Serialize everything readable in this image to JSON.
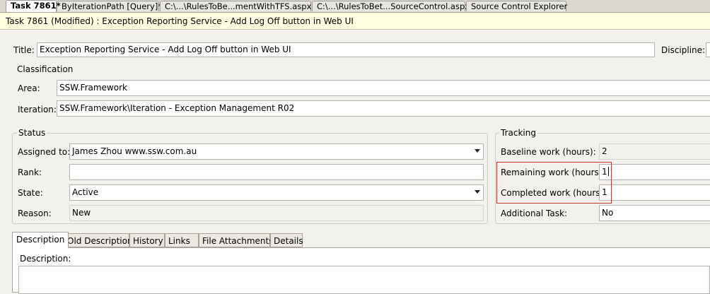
{
  "doc_tabs": [
    {
      "label": "Task 7861*",
      "active": true
    },
    {
      "label": "ByIterationPath [Query]*",
      "active": false
    },
    {
      "label": "C:\\...\\RulesToBe...mentWithTFS.aspx*",
      "active": false
    },
    {
      "label": "C:\\...\\RulesToBet...SourceControl.aspx",
      "active": false
    },
    {
      "label": "Source Control Explorer",
      "active": false
    }
  ],
  "header": {
    "title": "Task 7861 (Modified) : Exception Reporting Service -  Add Log Off button in Web UI"
  },
  "form": {
    "title_label": "Title:",
    "title_value": "Exception Reporting Service -  Add Log Off button in Web UI",
    "discipline_label": "Discipline:",
    "discipline_value": ""
  },
  "classification": {
    "heading": "Classification",
    "area_label": "Area:",
    "area_value": "SSW.Framework",
    "iteration_label": "Iteration:",
    "iteration_value": "SSW.Framework\\Iteration - Exception Management R02"
  },
  "status": {
    "heading": "Status",
    "assigned_label": "Assigned to:",
    "assigned_value": "James Zhou www.ssw.com.au",
    "rank_label": "Rank:",
    "rank_value": "",
    "state_label": "State:",
    "state_value": "Active",
    "reason_label": "Reason:",
    "reason_value": "New"
  },
  "tracking": {
    "heading": "Tracking",
    "baseline_label": "Baseline work (hours):",
    "baseline_value": "2",
    "remaining_label": "Remaining work (hours):",
    "remaining_value": "1",
    "completed_label": "Completed work (hours):",
    "completed_value": "1",
    "additional_label": "Additional Task:",
    "additional_value": "No"
  },
  "bottom_tabs": [
    "Description",
    "Old Description",
    "History",
    "Links",
    "File Attachments",
    "Details"
  ],
  "description": {
    "label": "Description:",
    "value": ""
  }
}
